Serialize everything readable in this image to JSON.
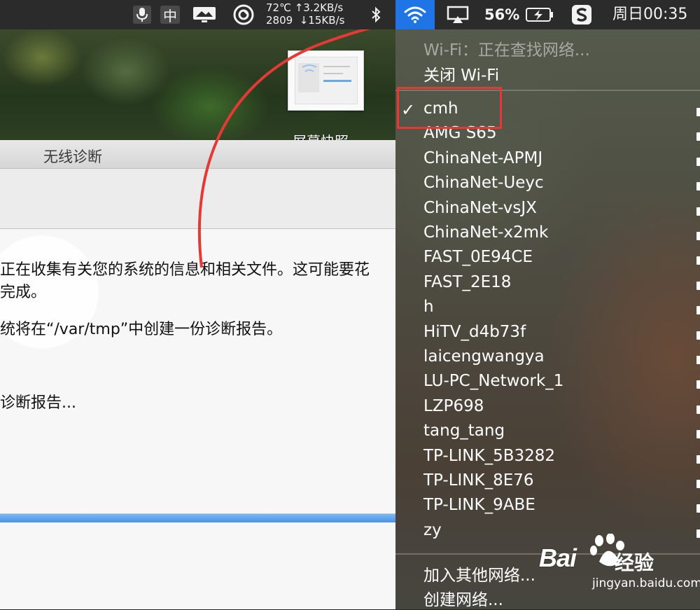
{
  "menubar": {
    "input_method": "中",
    "net_stats": {
      "temp": "72℃",
      "upload": "↑3.2KB/s",
      "fan": "2809",
      "download": "↓15KB/s"
    },
    "battery_percent": "56%",
    "clock": "周日00:35",
    "colors": {
      "bar": "#2b2b2b",
      "wifi_highlight": "#1f74e6"
    }
  },
  "desktop": {
    "screenshot_label": "屏幕快照"
  },
  "window": {
    "title": "无线诊断",
    "line1": "正在收集有关您的系统的信息和相关文件。这可能要花",
    "line2": "完成。",
    "line3": "统将在“/var/tmp”中创建一份诊断报告。",
    "status": "诊断报告...",
    "progress": 1.0
  },
  "wifi_menu": {
    "status_text": "Wi-Fi：正在查找网络...",
    "toggle_label": "关闭 Wi-Fi",
    "connected": "cmh",
    "networks": [
      "cmh",
      "AMG S65",
      "ChinaNet-APMJ",
      "ChinaNet-Ueyc",
      "ChinaNet-vsJX",
      "ChinaNet-x2mk",
      "FAST_0E94CE",
      "FAST_2E18",
      "h",
      "HiTV_d4b73f",
      "laicengwangya",
      "LU-PC_Network_1",
      "LZP698",
      "tang_tang",
      "TP-LINK_5B3282",
      "TP-LINK_8E76",
      "TP-LINK_9ABE",
      "zy"
    ],
    "join_other": "加入其他网络...",
    "create_network": "创建网络..."
  },
  "annotation": {
    "color": "#e53935"
  },
  "watermark": {
    "brand": "Bai",
    "brand_cn": "经验",
    "url": "jingyan.baidu.com"
  }
}
